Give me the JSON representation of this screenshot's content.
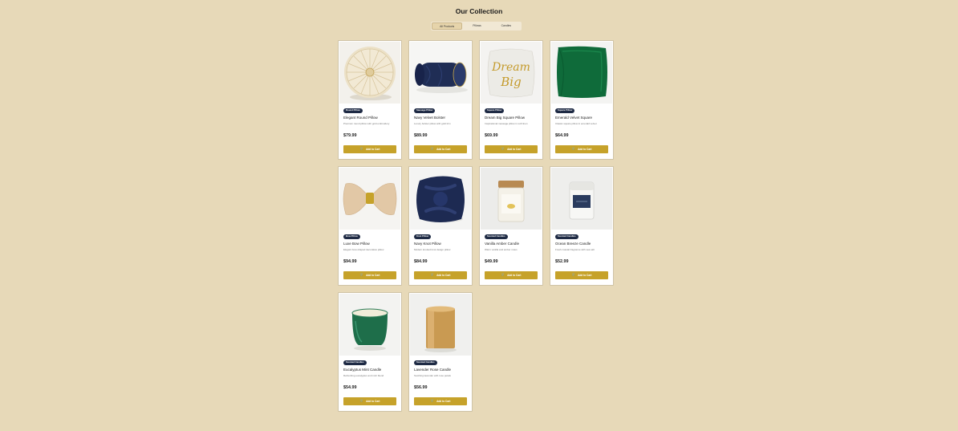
{
  "header": {
    "title": "Our Collection"
  },
  "tabs": [
    {
      "label": "All Products",
      "active": true
    },
    {
      "label": "Pillows",
      "active": false
    },
    {
      "label": "Candles",
      "active": false
    }
  ],
  "products": [
    {
      "badge": "Round Pillow",
      "name": "Elegant Round Pillow",
      "desc": "Premium round pillow with gold embroidery",
      "price": "$79.99",
      "button": "Add to Cart",
      "image": "round-pillow"
    },
    {
      "badge": "Sausage Pillow",
      "name": "Navy Velvet Bolster",
      "desc": "Luxury bolster pillow with gold trim",
      "price": "$89.99",
      "button": "Add to Cart",
      "image": "bolster-pillow"
    },
    {
      "badge": "Square Pillow",
      "name": "Dream Big Square Pillow",
      "desc": "Inspirational message pillow in soft linen",
      "price": "$69.99",
      "button": "Add to Cart",
      "image": "dream-big-pillow"
    },
    {
      "badge": "Square Pillow",
      "name": "Emerald Velvet Square",
      "desc": "Classic square pillow in emerald velvet",
      "price": "$64.99",
      "button": "Add to Cart",
      "image": "emerald-pillow"
    },
    {
      "badge": "Bow Pillow",
      "name": "Luxe Bow Pillow",
      "desc": "Elegant bow-shaped decorative pillow",
      "price": "$94.99",
      "button": "Add to Cart",
      "image": "bow-pillow"
    },
    {
      "badge": "Knot Pillow",
      "name": "Navy Knot Pillow",
      "desc": "Modern knotted knot design pillow",
      "price": "$84.99",
      "button": "Add to Cart",
      "image": "knot-pillow"
    },
    {
      "badge": "Scented Candles",
      "name": "Vanilla Amber Candle",
      "desc": "Warm vanilla and amber notes",
      "price": "$49.99",
      "button": "Add to Cart",
      "image": "vanilla-candle"
    },
    {
      "badge": "Scented Candles",
      "name": "Ocean Breeze Candle",
      "desc": "Fresh coastal fragrance with sea salt",
      "price": "$52.99",
      "button": "Add to Cart",
      "image": "ocean-candle"
    },
    {
      "badge": "Scented Candles",
      "name": "Eucalyptus Mint Candle",
      "desc": "Refreshing eucalyptus and mint blend",
      "price": "$54.99",
      "button": "Add to Cart",
      "image": "eucalyptus-candle"
    },
    {
      "badge": "Scented Candles",
      "name": "Lavender Rose Candle",
      "desc": "Soothing lavender with rose petals",
      "price": "$56.99",
      "button": "Add to Cart",
      "image": "lavender-candle"
    }
  ],
  "colors": {
    "background": "#e7d9b8",
    "accent": "#c6a22a",
    "badge": "#1e2a44"
  }
}
